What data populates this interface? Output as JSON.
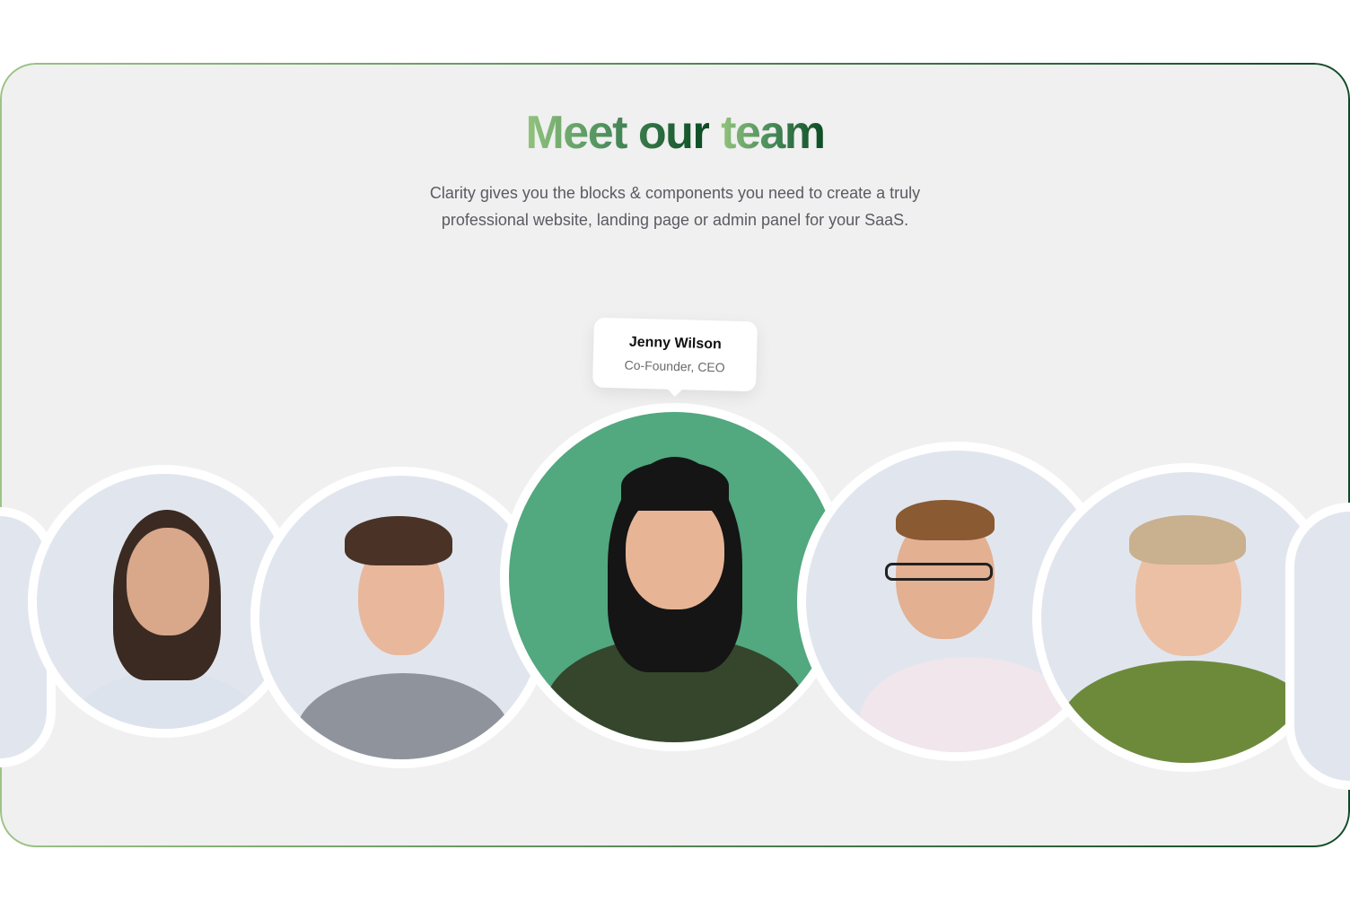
{
  "section": {
    "title_part1": "Meet our",
    "title_part2": "team",
    "subtitle": "Clarity gives you the blocks & components you need to create a truly professional website, landing page or admin panel for your SaaS."
  },
  "tooltip": {
    "name": "Jenny Wilson",
    "role": "Co-Founder, CEO"
  },
  "colors": {
    "accent_light": "#93c47d",
    "accent_dark": "#0b4a22",
    "featured_bg": "#52a87f",
    "avatar_bg": "#e1e6ee"
  }
}
